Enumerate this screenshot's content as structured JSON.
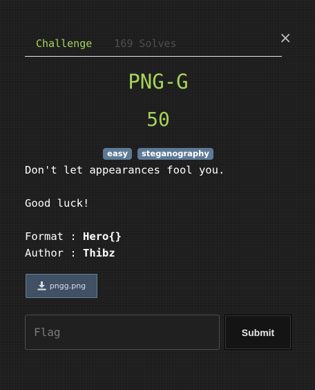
{
  "tabs": [
    {
      "label": "Challenge",
      "active": true
    },
    {
      "label": "169 Solves",
      "active": false
    }
  ],
  "close_label": "×",
  "challenge": {
    "name": "PNG-G",
    "points": "50",
    "tags": [
      "easy",
      "steganography"
    ],
    "description_lines": [
      "Don't let appearances fool you.",
      "",
      "Good luck!",
      ""
    ],
    "format_label": "Format : ",
    "format_value": "Hero{}",
    "author_label": "Author : ",
    "author_value": "Thibz"
  },
  "file": {
    "name": "pngg.png",
    "icon": "download-icon"
  },
  "flag_input": {
    "placeholder": "Flag",
    "value": ""
  },
  "submit_label": "Submit",
  "colors": {
    "accent": "#a6d45a",
    "tag_bg": "#5d7a95",
    "file_btn_bg": "#415165",
    "background": "#1d1d1d"
  }
}
